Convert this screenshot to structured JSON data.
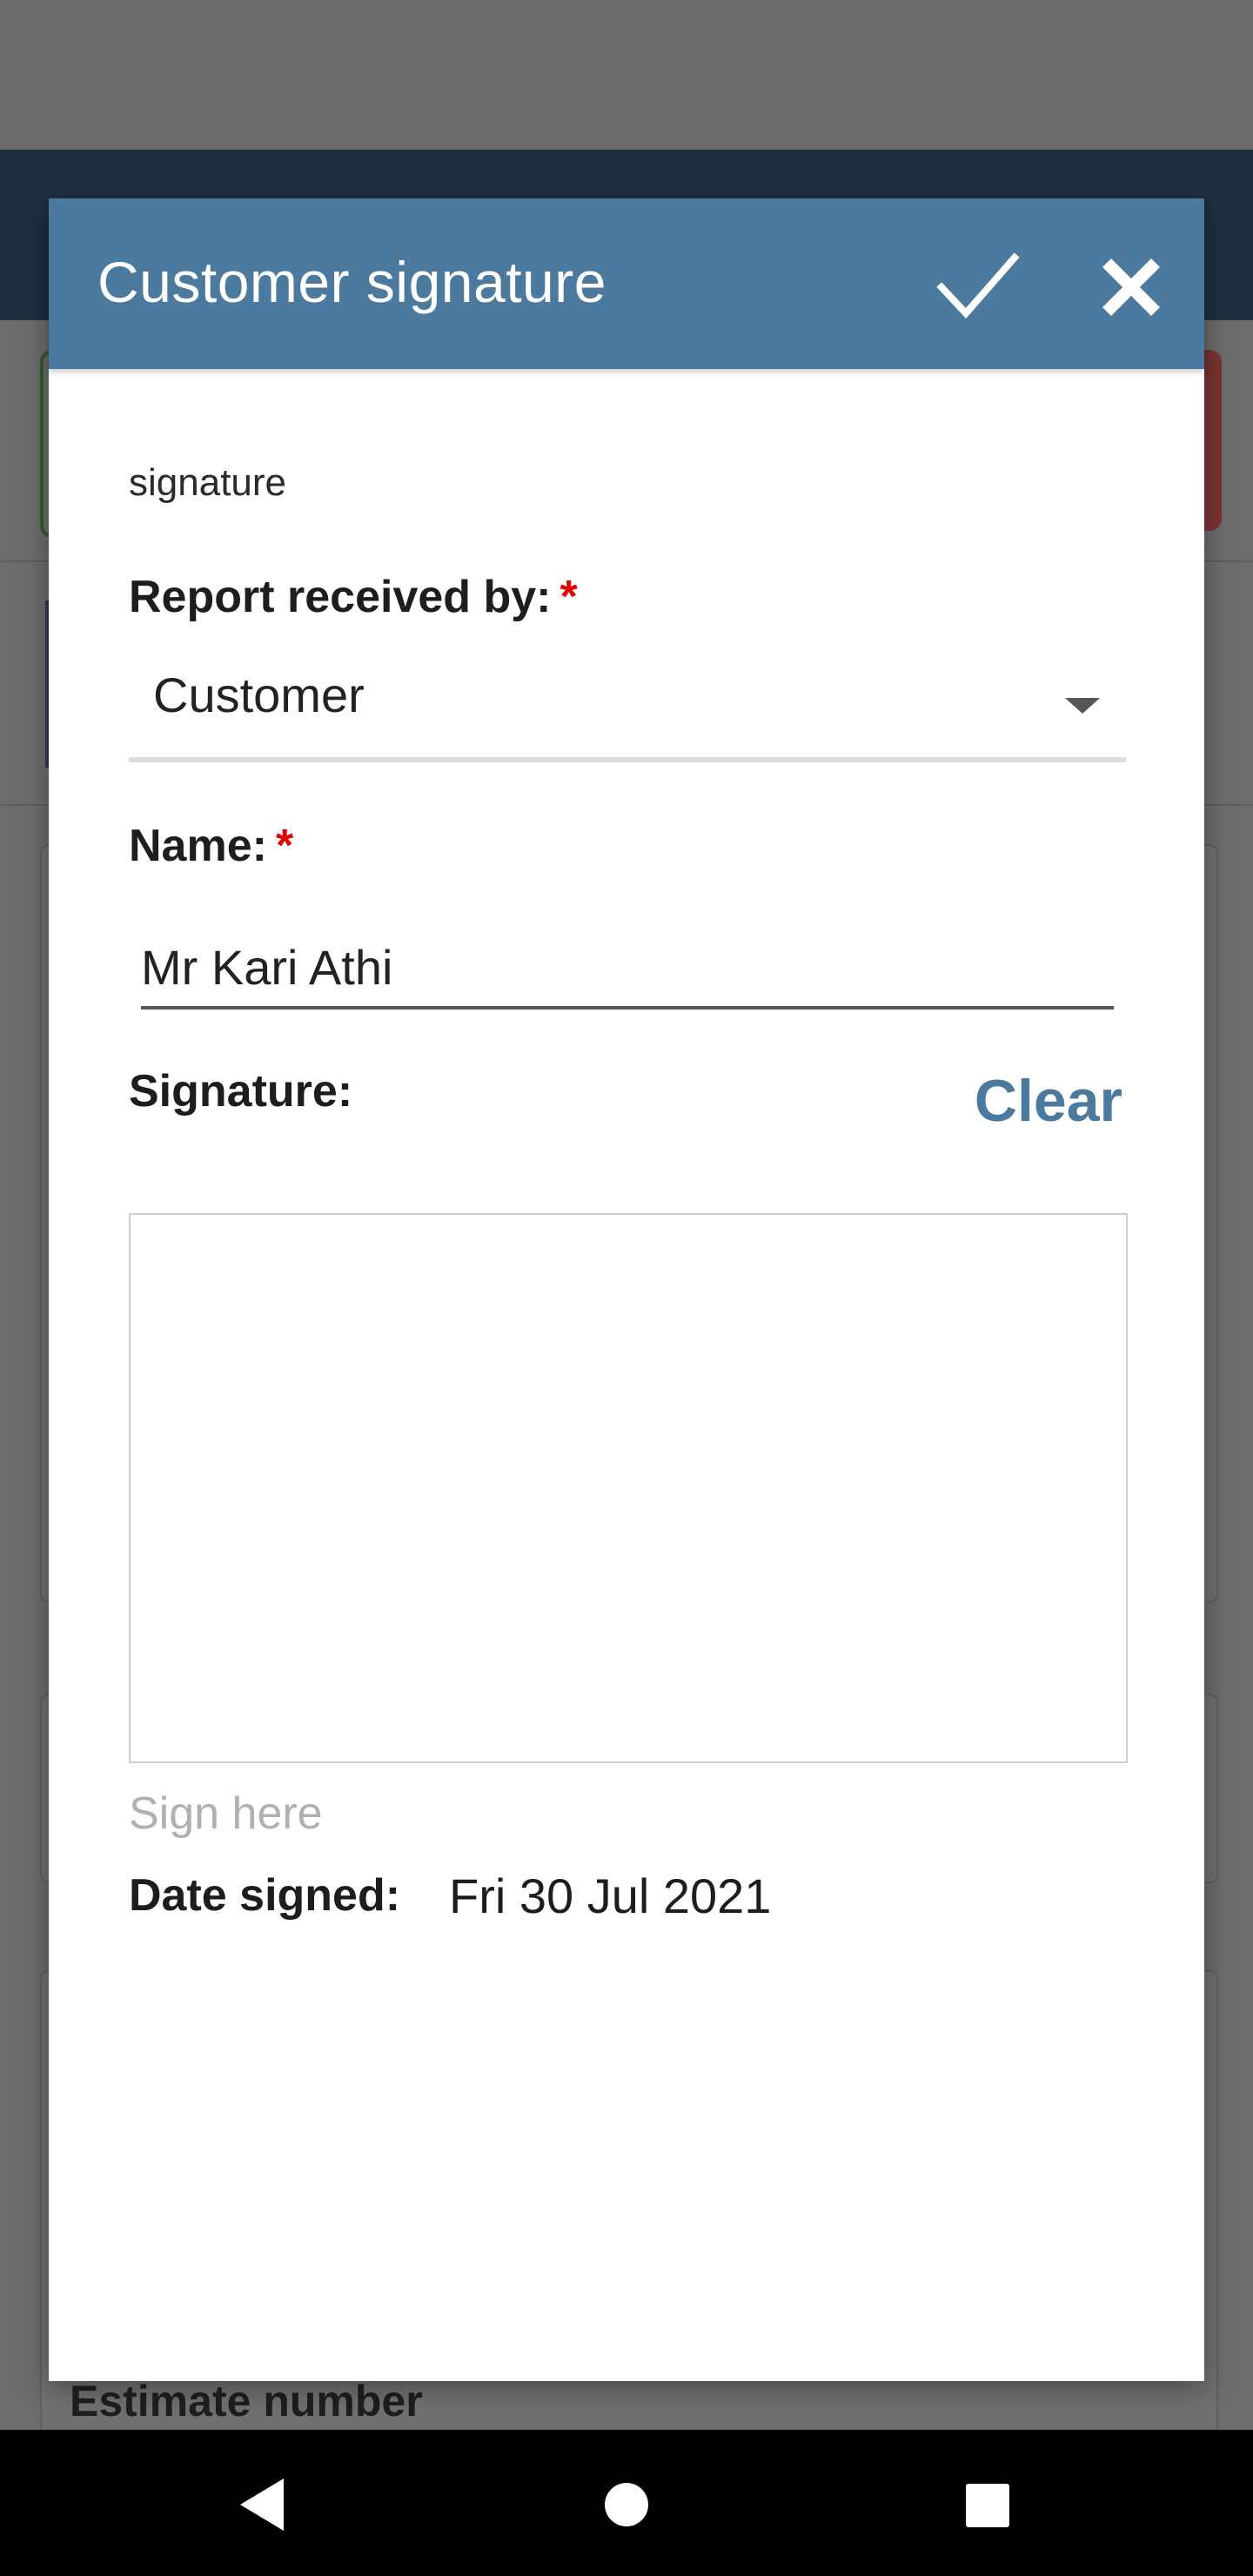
{
  "background": {
    "estimate_label": "Estimate number"
  },
  "dialog": {
    "title": "Customer signature",
    "confirm_icon": "check-icon",
    "close_icon": "close-icon",
    "caption": "signature",
    "report_received_by": {
      "label": "Report received by:",
      "required_marker": "*",
      "selected_value": "Customer"
    },
    "name": {
      "label": "Name:",
      "required_marker": "*",
      "value": "Mr Kari Athi"
    },
    "signature": {
      "label": "Signature:",
      "clear_label": "Clear",
      "hint": "Sign here"
    },
    "date_signed": {
      "label": "Date signed:",
      "value": "Fri 30 Jul 2021"
    }
  },
  "colors": {
    "header": "#4b7a9e",
    "accent": "#4b7a9e",
    "required": "#e00000"
  },
  "nav": {
    "back_icon": "back-triangle-icon",
    "home_icon": "home-circle-icon",
    "recent_icon": "recent-square-icon"
  }
}
